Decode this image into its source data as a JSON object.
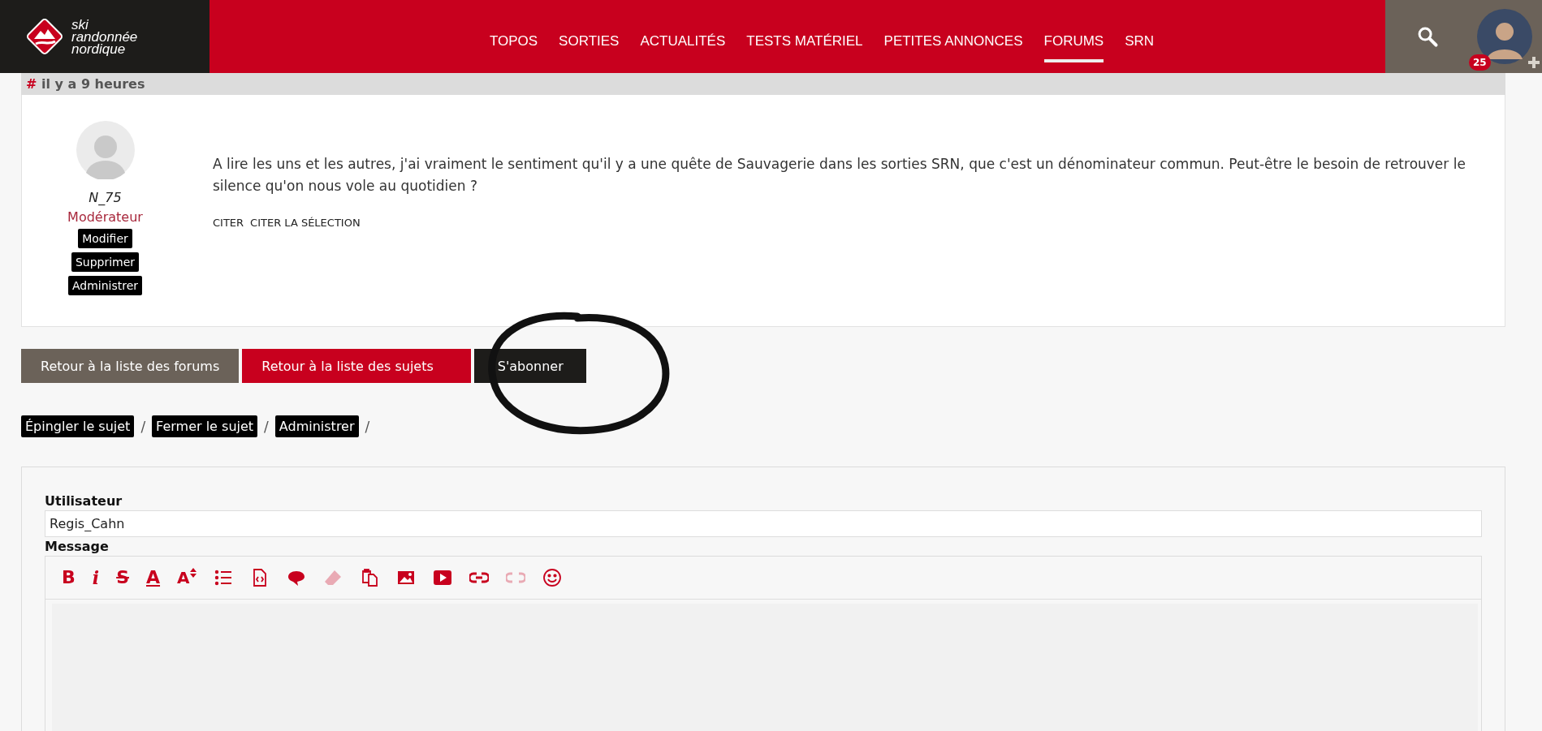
{
  "logo": {
    "lines": [
      "ski",
      "randonnée",
      "nordique"
    ]
  },
  "nav": [
    {
      "label": "TOPOS",
      "selected": false
    },
    {
      "label": "SORTIES",
      "selected": false
    },
    {
      "label": "ACTUALITÉS",
      "selected": false
    },
    {
      "label": "TESTS MATÉRIEL",
      "selected": false
    },
    {
      "label": "PETITES ANNONCES",
      "selected": false
    },
    {
      "label": "FORUMS",
      "selected": true
    },
    {
      "label": "SRN",
      "selected": false
    }
  ],
  "user_menu": {
    "badge": "25"
  },
  "post": {
    "hash": "#",
    "time": "il y a 9 heures",
    "author": "N_75",
    "role": "Modérateur",
    "author_actions": [
      "Modifier",
      "Supprimer",
      "Administrer"
    ],
    "body": "A lire les uns et les autres, j'ai vraiment le sentiment qu'il y a une quête de Sauvagerie dans les sorties SRN, que c'est un dénominateur commun. Peut-être le besoin de retrouver le silence qu'on nous vole au quotidien ?",
    "quote_links": [
      "CITER",
      "CITER LA SÉLECTION"
    ]
  },
  "buttons": [
    {
      "label": "Retour à la liste des forums",
      "kind": "neutral"
    },
    {
      "label": "Retour à la liste des sujets",
      "kind": "primary"
    },
    {
      "label": "S'abonner",
      "kind": "dark"
    }
  ],
  "topic_actions": {
    "items": [
      "Épingler le sujet",
      "Fermer le sujet",
      "Administrer"
    ],
    "separator": "/"
  },
  "form": {
    "user_label": "Utilisateur",
    "user_value": "Regis_Cahn",
    "message_label": "Message",
    "toolbar": [
      {
        "kind": "bold",
        "glyph": "B",
        "disabled": false
      },
      {
        "kind": "italic",
        "glyph": "i",
        "disabled": false
      },
      {
        "kind": "strike",
        "glyph": "S",
        "disabled": false
      },
      {
        "kind": "color",
        "glyph": "A",
        "disabled": false
      },
      {
        "kind": "size",
        "glyph": "A",
        "disabled": false
      },
      {
        "kind": "list",
        "disabled": false
      },
      {
        "kind": "code",
        "disabled": false
      },
      {
        "kind": "quote",
        "disabled": false
      },
      {
        "kind": "eraser",
        "disabled": true
      },
      {
        "kind": "paste",
        "disabled": false
      },
      {
        "kind": "image",
        "disabled": false
      },
      {
        "kind": "video",
        "disabled": false
      },
      {
        "kind": "link",
        "disabled": false
      },
      {
        "kind": "unlink",
        "disabled": true
      },
      {
        "kind": "emoji",
        "disabled": false
      }
    ]
  }
}
